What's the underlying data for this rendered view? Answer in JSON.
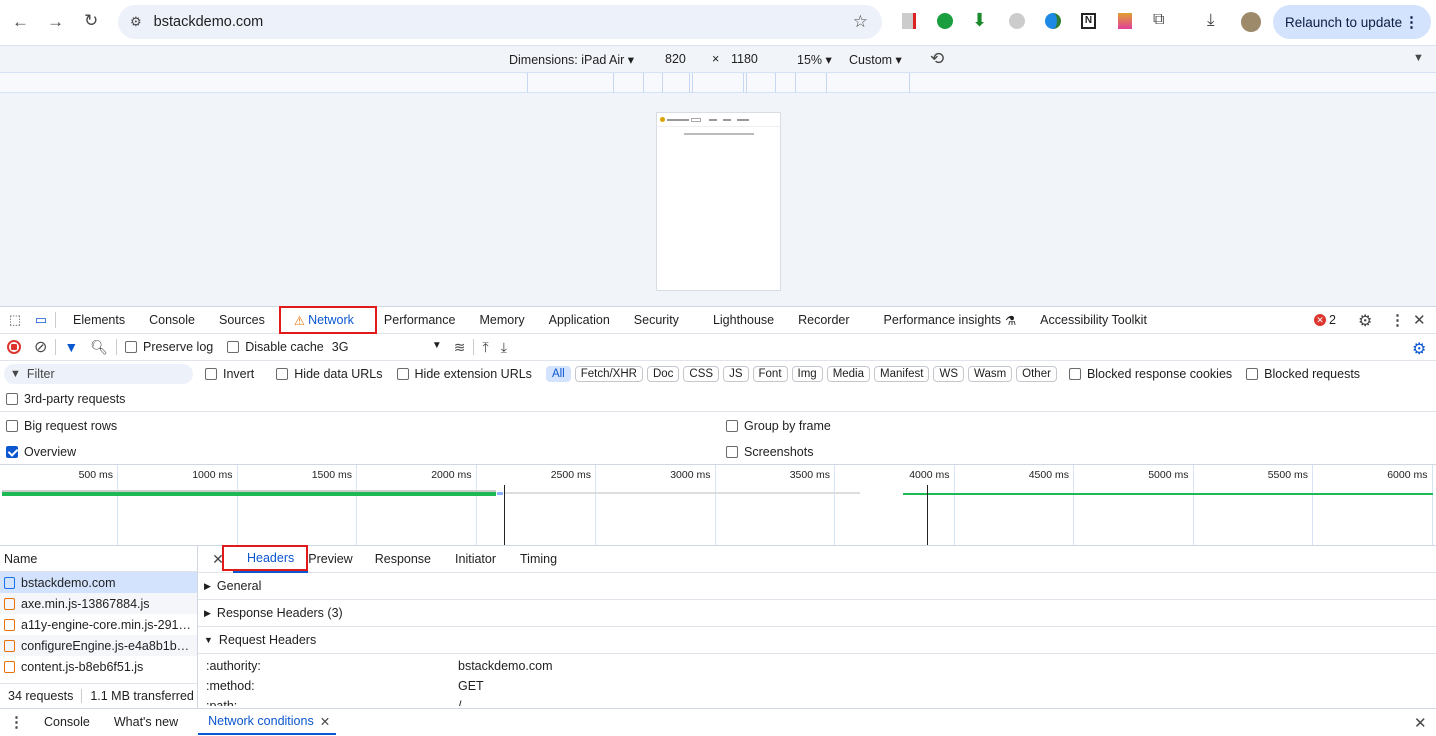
{
  "browser": {
    "url": "bstackdemo.com",
    "relaunch_label": "Relaunch to update"
  },
  "device_toolbar": {
    "dimensions_label": "Dimensions: iPad Air",
    "width": "820",
    "times": "×",
    "height": "1180",
    "zoom": "15%",
    "throttle": "Custom"
  },
  "devtools": {
    "tabs": [
      "Elements",
      "Console",
      "Sources",
      "Network",
      "Performance",
      "Memory",
      "Application",
      "Security",
      "Lighthouse",
      "Recorder",
      "Performance insights",
      "Accessibility Toolkit"
    ],
    "active_tab": "Network",
    "error_count": "2"
  },
  "network_toolbar": {
    "preserve_log": "Preserve log",
    "disable_cache": "Disable cache",
    "throttling": "3G"
  },
  "filter": {
    "placeholder": "Filter",
    "invert": "Invert",
    "hide_data_urls": "Hide data URLs",
    "hide_extension_urls": "Hide extension URLs",
    "types": [
      "All",
      "Fetch/XHR",
      "Doc",
      "CSS",
      "JS",
      "Font",
      "Img",
      "Media",
      "Manifest",
      "WS",
      "Wasm",
      "Other"
    ],
    "active_type": "All",
    "blocked_cookies": "Blocked response cookies",
    "blocked_requests": "Blocked requests",
    "third_party": "3rd-party requests"
  },
  "settings": {
    "big_rows": "Big request rows",
    "group_by_frame": "Group by frame",
    "overview": "Overview",
    "overview_checked": true,
    "screenshots": "Screenshots"
  },
  "overview": {
    "ticks": [
      "500 ms",
      "1000 ms",
      "1500 ms",
      "2000 ms",
      "2500 ms",
      "3000 ms",
      "3500 ms",
      "4000 ms",
      "4500 ms",
      "5000 ms",
      "5500 ms",
      "6000 ms"
    ]
  },
  "requests": {
    "column": "Name",
    "items": [
      "bstackdemo.com",
      "axe.min.js-13867884.js",
      "a11y-engine-core.min.js-291…",
      "configureEngine.js-e4a8b1b…",
      "content.js-b8eb6f51.js"
    ],
    "selected": 0,
    "count": "34 requests",
    "transferred": "1.1 MB transferred"
  },
  "detail": {
    "tabs": [
      "Headers",
      "Preview",
      "Response",
      "Initiator",
      "Timing"
    ],
    "active_tab": "Headers",
    "sections": [
      "General",
      "Response Headers (3)",
      "Request Headers"
    ],
    "request_headers": [
      {
        "k": ":authority:",
        "v": "bstackdemo.com"
      },
      {
        "k": ":method:",
        "v": "GET"
      },
      {
        "k": ":path:",
        "v": "/"
      }
    ]
  },
  "drawer": {
    "tabs": [
      "Console",
      "What's new",
      "Network conditions"
    ],
    "active_tab": "Network conditions"
  },
  "colors": {
    "accent": "#0b57d0",
    "highlight": "#e01a1a",
    "bar_green": "#1db954"
  }
}
